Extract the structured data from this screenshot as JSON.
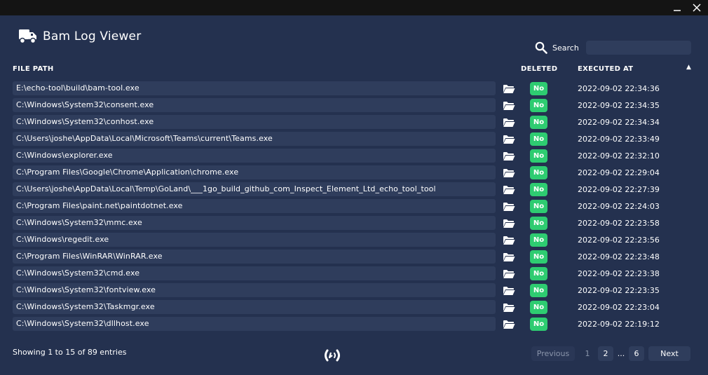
{
  "window": {
    "minimize_glyph": "–",
    "close_glyph": "✕"
  },
  "header": {
    "title": "Bam Log Viewer",
    "icon": "truck-icon"
  },
  "search": {
    "label": "Search",
    "value": "",
    "placeholder": ""
  },
  "table": {
    "columns": {
      "path": "FILE PATH",
      "deleted": "DELETED",
      "executed": "EXECUTED AT"
    },
    "sort_indicator": "▲",
    "rows": [
      {
        "path": "E:\\echo-tool\\build\\bam-tool.exe",
        "deleted": "No",
        "executed": "2022-09-02 22:34:36"
      },
      {
        "path": "C:\\Windows\\System32\\consent.exe",
        "deleted": "No",
        "executed": "2022-09-02 22:34:35"
      },
      {
        "path": "C:\\Windows\\System32\\conhost.exe",
        "deleted": "No",
        "executed": "2022-09-02 22:34:34"
      },
      {
        "path": "C:\\Users\\joshe\\AppData\\Local\\Microsoft\\Teams\\current\\Teams.exe",
        "deleted": "No",
        "executed": "2022-09-02 22:33:49"
      },
      {
        "path": "C:\\Windows\\explorer.exe",
        "deleted": "No",
        "executed": "2022-09-02 22:32:10"
      },
      {
        "path": "C:\\Program Files\\Google\\Chrome\\Application\\chrome.exe",
        "deleted": "No",
        "executed": "2022-09-02 22:29:04"
      },
      {
        "path": "C:\\Users\\joshe\\AppData\\Local\\Temp\\GoLand\\___1go_build_github_com_Inspect_Element_Ltd_echo_tool_tool",
        "deleted": "No",
        "executed": "2022-09-02 22:27:39"
      },
      {
        "path": "C:\\Program Files\\paint.net\\paintdotnet.exe",
        "deleted": "No",
        "executed": "2022-09-02 22:24:03"
      },
      {
        "path": "C:\\Windows\\System32\\mmc.exe",
        "deleted": "No",
        "executed": "2022-09-02 22:23:58"
      },
      {
        "path": "C:\\Windows\\regedit.exe",
        "deleted": "No",
        "executed": "2022-09-02 22:23:56"
      },
      {
        "path": "C:\\Program Files\\WinRAR\\WinRAR.exe",
        "deleted": "No",
        "executed": "2022-09-02 22:23:48"
      },
      {
        "path": "C:\\Windows\\System32\\cmd.exe",
        "deleted": "No",
        "executed": "2022-09-02 22:23:38"
      },
      {
        "path": "C:\\Windows\\System32\\fontview.exe",
        "deleted": "No",
        "executed": "2022-09-02 22:23:35"
      },
      {
        "path": "C:\\Windows\\System32\\Taskmgr.exe",
        "deleted": "No",
        "executed": "2022-09-02 22:23:04"
      },
      {
        "path": "C:\\Windows\\System32\\dllhost.exe",
        "deleted": "No",
        "executed": "2022-09-02 22:19:12"
      }
    ]
  },
  "footer": {
    "showing": "Showing 1 to 15 of 89 entries",
    "pagination": {
      "previous": "Previous",
      "page1": "1",
      "page2": "2",
      "ellipsis": "...",
      "page6": "6",
      "next": "Next"
    }
  },
  "colors": {
    "background": "#24314f",
    "cell": "#2f3d5c",
    "badge": "#2ecc71",
    "titlebar": "#141414"
  }
}
